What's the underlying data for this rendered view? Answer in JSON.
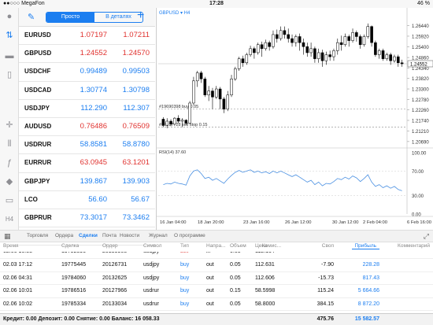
{
  "status_bar": {
    "carrier": "●●○○○ MegaFon",
    "time": "17:28",
    "battery": "46 %"
  },
  "quotes_header": {
    "segment_simple": "Просто",
    "segment_detailed": "В деталях"
  },
  "quotes": [
    {
      "symbol": "EURUSD",
      "bid": "1.07197",
      "ask": "1.07211",
      "dir": "down"
    },
    {
      "symbol": "GBPUSD",
      "bid": "1.24552",
      "ask": "1.24570",
      "dir": "down"
    },
    {
      "symbol": "USDCHF",
      "bid": "0.99489",
      "ask": "0.99503",
      "dir": "up"
    },
    {
      "symbol": "USDCAD",
      "bid": "1.30774",
      "ask": "1.30798",
      "dir": "up"
    },
    {
      "symbol": "USDJPY",
      "bid": "112.290",
      "ask": "112.307",
      "dir": "up"
    },
    {
      "symbol": "AUDUSD",
      "bid": "0.76486",
      "ask": "0.76509",
      "dir": "down"
    },
    {
      "symbol": "USDRUR",
      "bid": "58.8581",
      "ask": "58.8780",
      "dir": "up"
    },
    {
      "symbol": "EURRUR",
      "bid": "63.0945",
      "ask": "63.1201",
      "dir": "down"
    },
    {
      "symbol": "GBPJPY",
      "bid": "139.867",
      "ask": "139.903",
      "dir": "up"
    },
    {
      "symbol": "LCO",
      "bid": "56.60",
      "ask": "56.67",
      "dir": "up"
    },
    {
      "symbol": "GBPRUR",
      "bid": "73.3017",
      "ask": "73.3462",
      "dir": "up"
    },
    {
      "symbol": "GBPAUD",
      "bid": "1.62814",
      "ask": "1.62857",
      "dir": "up"
    }
  ],
  "chart": {
    "symbol_label": "GBPUSD ▾ H4",
    "current_price": "1.24552",
    "price_ticks": [
      "1.26440",
      "1.25920",
      "1.25400",
      "1.24860",
      "1.24340",
      "1.23820",
      "1.23300",
      "1.22780",
      "1.22260",
      "1.21740",
      "1.21210",
      "1.20690"
    ],
    "order_lines": [
      {
        "label": "#19690398 buy 0.05",
        "price": 1.2231
      },
      {
        "label": "#19917728 sell stop 0.15",
        "price": 1.2141
      }
    ],
    "rsi_label": "RSI(14) 37.60",
    "rsi_ticks": [
      "100.00",
      "70.00",
      "30.00",
      "0.00"
    ],
    "time_ticks": [
      "16 Jan 04:00",
      "18 Jan 20:00",
      "23 Jan 16:00",
      "26 Jan 12:00",
      "30 Jan 12:00",
      "2 Feb 04:00",
      "6 Feb 16:00"
    ]
  },
  "chart_data": {
    "type": "candlestick",
    "symbol": "GBPUSD",
    "timeframe": "H4",
    "ylim": [
      1.2045,
      1.267
    ],
    "candles": [
      [
        1.218,
        1.215,
        1.219,
        1.214
      ],
      [
        1.215,
        1.217,
        1.2185,
        1.2135
      ],
      [
        1.217,
        1.2155,
        1.218,
        1.2145
      ],
      [
        1.2155,
        1.2185,
        1.219,
        1.215
      ],
      [
        1.2185,
        1.217,
        1.22,
        1.216
      ],
      [
        1.217,
        1.2175,
        1.2185,
        1.214
      ],
      [
        1.2175,
        1.216,
        1.218,
        1.215
      ],
      [
        1.216,
        1.226,
        1.227,
        1.2155
      ],
      [
        1.226,
        1.237,
        1.239,
        1.225
      ],
      [
        1.237,
        1.241,
        1.242,
        1.234
      ],
      [
        1.241,
        1.238,
        1.242,
        1.236
      ],
      [
        1.238,
        1.23,
        1.239,
        1.229
      ],
      [
        1.23,
        1.232,
        1.2345,
        1.227
      ],
      [
        1.232,
        1.229,
        1.2335,
        1.223
      ],
      [
        1.229,
        1.233,
        1.2345,
        1.228
      ],
      [
        1.233,
        1.228,
        1.234,
        1.223
      ],
      [
        1.228,
        1.223,
        1.229,
        1.221
      ],
      [
        1.223,
        1.23,
        1.232,
        1.222
      ],
      [
        1.23,
        1.238,
        1.24,
        1.229
      ],
      [
        1.238,
        1.243,
        1.244,
        1.237
      ],
      [
        1.243,
        1.248,
        1.249,
        1.242
      ],
      [
        1.248,
        1.246,
        1.2495,
        1.244
      ],
      [
        1.246,
        1.25,
        1.251,
        1.245
      ],
      [
        1.25,
        1.253,
        1.2545,
        1.249
      ],
      [
        1.253,
        1.251,
        1.254,
        1.248
      ],
      [
        1.251,
        1.255,
        1.256,
        1.25
      ],
      [
        1.255,
        1.253,
        1.2565,
        1.249
      ],
      [
        1.253,
        1.256,
        1.2575,
        1.252
      ],
      [
        1.256,
        1.254,
        1.257,
        1.252
      ],
      [
        1.254,
        1.26,
        1.262,
        1.253
      ],
      [
        1.26,
        1.258,
        1.2625,
        1.256
      ],
      [
        1.258,
        1.262,
        1.264,
        1.257
      ],
      [
        1.262,
        1.26,
        1.264,
        1.258
      ],
      [
        1.26,
        1.258,
        1.263,
        1.256
      ],
      [
        1.258,
        1.256,
        1.26,
        1.254
      ],
      [
        1.256,
        1.259,
        1.26,
        1.254
      ],
      [
        1.259,
        1.256,
        1.2605,
        1.252
      ],
      [
        1.256,
        1.254,
        1.258,
        1.25
      ],
      [
        1.254,
        1.251,
        1.256,
        1.249
      ],
      [
        1.251,
        1.253,
        1.256,
        1.249
      ],
      [
        1.253,
        1.248,
        1.254,
        1.246
      ],
      [
        1.248,
        1.251,
        1.253,
        1.246
      ],
      [
        1.251,
        1.247,
        1.2525,
        1.244
      ],
      [
        1.247,
        1.25,
        1.2515,
        1.245
      ],
      [
        1.25,
        1.249,
        1.252,
        1.247
      ],
      [
        1.249,
        1.252,
        1.253,
        1.247
      ],
      [
        1.252,
        1.256,
        1.258,
        1.25
      ],
      [
        1.256,
        1.255,
        1.2595,
        1.252
      ],
      [
        1.255,
        1.259,
        1.2605,
        1.254
      ],
      [
        1.259,
        1.257,
        1.26,
        1.254
      ],
      [
        1.257,
        1.261,
        1.263,
        1.256
      ],
      [
        1.261,
        1.259,
        1.262,
        1.2565
      ],
      [
        1.259,
        1.255,
        1.26,
        1.253
      ],
      [
        1.255,
        1.259,
        1.26,
        1.254
      ],
      [
        1.259,
        1.264,
        1.2655,
        1.258
      ],
      [
        1.264,
        1.256,
        1.2645,
        1.254
      ],
      [
        1.256,
        1.25,
        1.257,
        1.249
      ],
      [
        1.25,
        1.252,
        1.253,
        1.248
      ],
      [
        1.252,
        1.248,
        1.253,
        1.247
      ],
      [
        1.248,
        1.25,
        1.251,
        1.247
      ],
      [
        1.25,
        1.247,
        1.251,
        1.245
      ],
      [
        1.247,
        1.249,
        1.25,
        1.246
      ],
      [
        1.249,
        1.246,
        1.25,
        1.244
      ],
      [
        1.246,
        1.2455,
        1.2475,
        1.244
      ]
    ],
    "rsi": {
      "name": "RSI(14)",
      "ylim": [
        0,
        100
      ],
      "values": [
        48,
        50,
        49,
        52,
        50,
        49,
        47,
        62,
        70,
        72,
        66,
        58,
        60,
        55,
        58,
        54,
        50,
        57,
        63,
        68,
        71,
        68,
        70,
        72,
        68,
        70,
        67,
        69,
        66,
        70,
        67,
        70,
        67,
        64,
        61,
        64,
        60,
        56,
        52,
        55,
        48,
        52,
        46,
        50,
        49,
        53,
        58,
        56,
        60,
        57,
        62,
        59,
        53,
        58,
        64,
        52,
        45,
        48,
        43,
        46,
        42,
        45,
        40,
        38
      ]
    }
  },
  "bottom_tabs": [
    "Торговля",
    "Ордера",
    "Сделки",
    "Почта",
    "Новости",
    "Журнал",
    "О программе"
  ],
  "active_tab": "Сделки",
  "trades": {
    "headers": {
      "time": "Время",
      "deal": "Сделка",
      "order": "Ордер",
      "symbol": "Символ",
      "type": "Тип",
      "direction": "Напра...",
      "volume": "Объем",
      "price": "Цена",
      "commission": "Комис...",
      "swap": "Своп",
      "profit": "Прибыль",
      "comment": "Комментарий"
    },
    "partial_row": {
      "time": "02.06 16:58",
      "deal": "19792890",
      "order": "20139908",
      "symbol": "usdjpy",
      "type": "sell",
      "direction": "in",
      "volume": "0.05",
      "price": "112.164",
      "commission": "",
      "swap": "",
      "profit": ""
    },
    "rows": [
      {
        "time": "02.03 17:12",
        "deal": "19775445",
        "order": "20126731",
        "symbol": "usdjpy",
        "type": "buy",
        "direction": "out",
        "volume": "0.05",
        "price": "112.631",
        "commission": "",
        "swap": "-7.90",
        "profit": "228.28"
      },
      {
        "time": "02.06 04:31",
        "deal": "19784060",
        "order": "20132625",
        "symbol": "usdjpy",
        "type": "buy",
        "direction": "out",
        "volume": "0.05",
        "price": "112.606",
        "commission": "",
        "swap": "-15.73",
        "profit": "817.43"
      },
      {
        "time": "02.06 10:01",
        "deal": "19786516",
        "order": "20127966",
        "symbol": "usdrur",
        "type": "buy",
        "direction": "out",
        "volume": "0.15",
        "price": "58.5998",
        "commission": "",
        "swap": "115.24",
        "profit": "5 664.66"
      },
      {
        "time": "02.06 10:02",
        "deal": "19785334",
        "order": "20133034",
        "symbol": "usdrur",
        "type": "buy",
        "direction": "out",
        "volume": "0.05",
        "price": "58.8000",
        "commission": "",
        "swap": "384.15",
        "profit": "8 872.20"
      }
    ],
    "summary_text": "Кредит: 0.00 Депозит: 0.00 Снятие: 0.00 Баланс: 16 058.33",
    "summary_swap": "475.76",
    "summary_profit": "15 582.57"
  }
}
